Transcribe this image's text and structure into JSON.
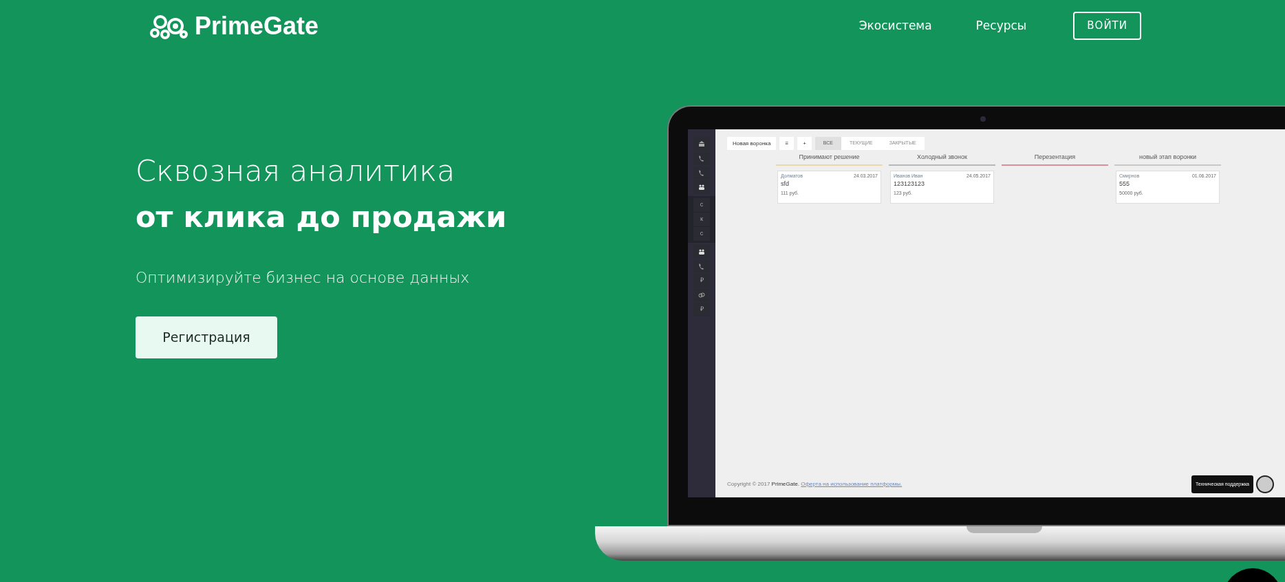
{
  "nav": {
    "logo": "PrimeGate",
    "links": [
      "Экосистема",
      "Ресурсы"
    ],
    "login": "ВОЙТИ"
  },
  "hero": {
    "title_light": "Сквозная аналитика",
    "title_bold": "от клика до продажи",
    "subtitle": "Оптимизируйте бизнес на основе данных",
    "cta": "Регистрация"
  },
  "app": {
    "sidebar": [
      [
        {
          "kind": "building"
        },
        {
          "kind": "phone"
        },
        {
          "kind": "phone"
        },
        {
          "kind": "people"
        }
      ],
      [
        {
          "kind": "letter",
          "text": "с"
        },
        {
          "kind": "letter",
          "text": "к"
        },
        {
          "kind": "letter",
          "text": "с"
        }
      ],
      [
        {
          "kind": "people"
        },
        {
          "kind": "phone"
        },
        {
          "kind": "letter",
          "text": "₽"
        },
        {
          "kind": "link"
        },
        {
          "kind": "letter",
          "text": "₽"
        }
      ]
    ],
    "toolbar": {
      "funnel": "Новая воронка",
      "menu": "≡",
      "add": "+"
    },
    "tabs": [
      {
        "label": "ВСЕ",
        "selected": true
      },
      {
        "label": "ТЕКУЩИЕ",
        "selected": false
      },
      {
        "label": "ЗАКРЫТЫЕ",
        "selected": false
      }
    ],
    "columns": [
      {
        "title": "Принимают решение",
        "color": "#e8d9a8",
        "cards": [
          {
            "name": "Долматов",
            "date": "24.03.2017",
            "title": "sfd",
            "price": "111 руб."
          }
        ]
      },
      {
        "title": "Холодный звонок",
        "color": "#b8b8b8",
        "cards": [
          {
            "name": "Иванов Иван",
            "date": "24.05.2017",
            "title": "123123123",
            "price": "123 руб."
          }
        ]
      },
      {
        "title": "Перезентация",
        "color": "#d9919a"
      },
      {
        "title": "новый этап воронки",
        "color": "#c8c8c8",
        "cards": [
          {
            "name": "Смирнов",
            "date": "01.06.2017",
            "title": "555",
            "price": "50000 руб."
          }
        ]
      }
    ],
    "footer": {
      "copyright": "Copyright © 2017",
      "brand": "PrimeGate.",
      "offer_link": "Оферта на использование платформы."
    },
    "support": "Техническая поддержка"
  }
}
